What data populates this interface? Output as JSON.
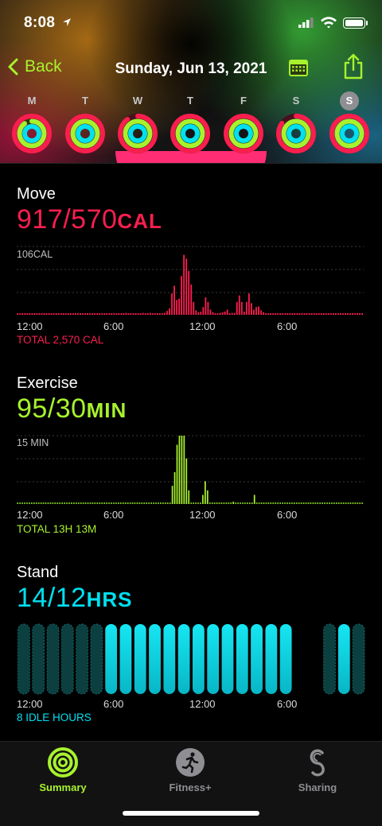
{
  "status_bar": {
    "time": "8:08"
  },
  "nav": {
    "back_label": "Back",
    "title": "Sunday, Jun 13, 2021"
  },
  "week": {
    "days": [
      {
        "letter": "M",
        "move": 1.0,
        "exercise": 0.9,
        "stand": 1.0
      },
      {
        "letter": "T",
        "move": 1.0,
        "exercise": 1.0,
        "stand": 1.0
      },
      {
        "letter": "W",
        "move": 0.9,
        "exercise": 1.0,
        "stand": 1.0
      },
      {
        "letter": "T",
        "move": 1.0,
        "exercise": 1.0,
        "stand": 1.0
      },
      {
        "letter": "F",
        "move": 1.0,
        "exercise": 1.0,
        "stand": 1.0
      },
      {
        "letter": "S",
        "move": 0.85,
        "exercise": 1.0,
        "stand": 1.0
      },
      {
        "letter": "S",
        "move": 1.0,
        "exercise": 1.0,
        "stand": 1.0,
        "selected": true
      }
    ]
  },
  "move": {
    "label": "Move",
    "value": "917/570",
    "unit": "CAL",
    "scale_label": "106CAL",
    "x_ticks": [
      "12:00",
      "6:00",
      "12:00",
      "6:00"
    ],
    "total": "TOTAL 2,570 CAL",
    "color": "#fa1e4e"
  },
  "exercise": {
    "label": "Exercise",
    "value": "95/30",
    "unit": "MIN",
    "scale_label": "15 MIN",
    "x_ticks": [
      "12:00",
      "6:00",
      "12:00",
      "6:00"
    ],
    "total": "TOTAL 13H 13M",
    "color": "#a8f22d"
  },
  "stand": {
    "label": "Stand",
    "value": "14/12",
    "unit": "HRS",
    "x_ticks": [
      "12:00",
      "6:00",
      "12:00",
      "6:00"
    ],
    "total": "8 IDLE HOURS",
    "color": "#00e0f0"
  },
  "chart_data": [
    {
      "type": "bar",
      "title": "Move",
      "ylabel": "106CAL",
      "x_ticks": [
        "12:00",
        "6:00",
        "12:00",
        "6:00"
      ],
      "values": [
        1,
        1,
        1,
        1,
        1,
        1,
        1,
        1,
        1,
        1,
        1,
        1,
        1,
        1,
        1,
        1,
        1,
        1,
        1,
        1,
        1,
        1,
        1,
        1,
        1,
        1,
        1,
        1,
        1,
        1,
        1,
        1,
        1,
        1,
        1,
        1,
        1,
        1,
        1,
        1,
        1,
        1,
        1,
        1,
        2,
        3,
        2,
        1,
        2,
        1,
        2,
        2,
        3,
        2,
        2,
        3,
        2,
        2,
        2,
        1,
        1,
        3,
        6,
        10,
        33,
        45,
        23,
        25,
        60,
        93,
        87,
        68,
        47,
        20,
        7,
        4,
        5,
        12,
        27,
        20,
        8,
        4,
        2,
        2,
        3,
        4,
        5,
        8,
        2,
        3,
        3,
        20,
        30,
        20,
        5,
        20,
        33,
        18,
        8,
        12,
        13,
        7,
        4,
        2,
        2,
        2,
        1,
        1,
        1,
        1,
        1,
        1,
        1,
        1,
        1,
        1,
        1,
        1,
        1,
        1,
        1,
        1,
        1,
        1,
        1,
        1,
        1,
        1,
        1,
        1,
        1,
        1,
        1,
        1,
        1,
        1,
        1,
        1,
        1,
        1,
        1,
        1,
        1,
        1
      ],
      "ylim": [
        0,
        106
      ]
    },
    {
      "type": "bar",
      "title": "Exercise",
      "ylabel": "15 MIN",
      "x_ticks": [
        "12:00",
        "6:00",
        "12:00",
        "6:00"
      ],
      "values": [
        0,
        0,
        0,
        0,
        0,
        0,
        0,
        0,
        0,
        0,
        0,
        0,
        0,
        0,
        0,
        0,
        0,
        0,
        0,
        0,
        0,
        0,
        0,
        0,
        0,
        0,
        0,
        0,
        0,
        0,
        0,
        0,
        0,
        0,
        0,
        0,
        0,
        0,
        0,
        0,
        0,
        0,
        0,
        0,
        0,
        0,
        0,
        0,
        0,
        0,
        0,
        0,
        0,
        0,
        0,
        0,
        0,
        0,
        0,
        0,
        0,
        0,
        0,
        0,
        0,
        0,
        4,
        7,
        13,
        15,
        15,
        15,
        10,
        3,
        0,
        0,
        0,
        0,
        0,
        2,
        5,
        3,
        0,
        0,
        0,
        0,
        0,
        0,
        0,
        0,
        0,
        0,
        0.5,
        0,
        0,
        0,
        0,
        0,
        0,
        0,
        0,
        2,
        0,
        0,
        0,
        0,
        0,
        0,
        0,
        0,
        0,
        0,
        0,
        0,
        0,
        0,
        0,
        0,
        0,
        0,
        0,
        0,
        0,
        0,
        0,
        0,
        0,
        0,
        0,
        0,
        0,
        0,
        0,
        0,
        0,
        0,
        0,
        0,
        0,
        0,
        0,
        0,
        0,
        0,
        0,
        0,
        0,
        0
      ],
      "ylim": [
        0,
        15
      ]
    },
    {
      "type": "bar",
      "title": "Stand",
      "x_ticks": [
        "12:00",
        "6:00",
        "12:00",
        "6:00"
      ],
      "values": [
        0,
        0,
        0,
        0,
        0,
        0,
        1,
        1,
        1,
        1,
        1,
        1,
        1,
        1,
        1,
        1,
        1,
        1,
        1,
        0,
        0,
        0,
        1,
        0
      ],
      "ylim": [
        0,
        1
      ]
    }
  ]
}
